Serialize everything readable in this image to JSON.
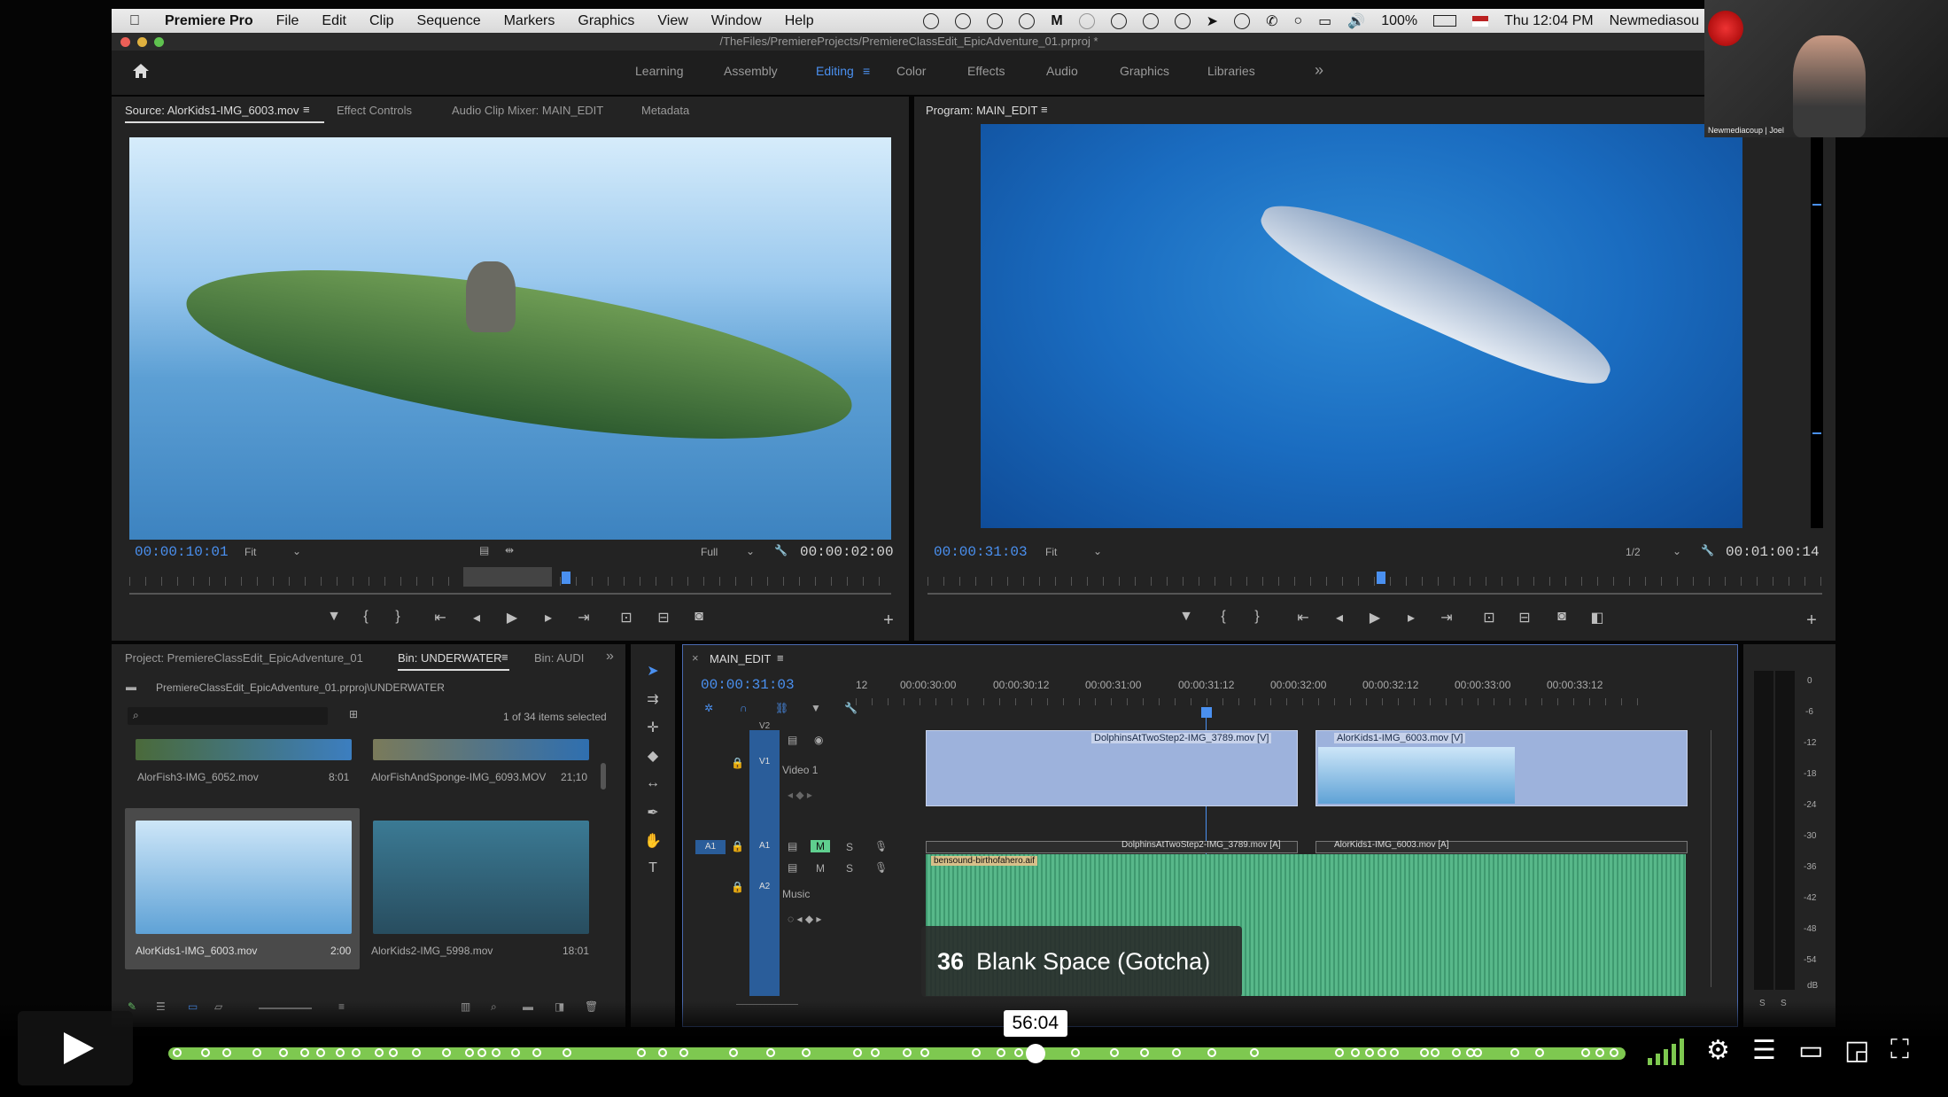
{
  "menubar": {
    "app": "Premiere Pro",
    "items": [
      "File",
      "Edit",
      "Clip",
      "Sequence",
      "Markers",
      "Graphics",
      "View",
      "Window",
      "Help"
    ],
    "battery": "100%",
    "clock": "Thu 12:04 PM",
    "user": "Newmediasou"
  },
  "titlebar": {
    "path": "/TheFiles/PremiereProjects/PremiereClassEdit_EpicAdventure_01.prproj *"
  },
  "workspaces": {
    "items": [
      {
        "label": "Learning"
      },
      {
        "label": "Assembly"
      },
      {
        "label": "Editing"
      },
      {
        "label": "Color"
      },
      {
        "label": "Effects"
      },
      {
        "label": "Audio"
      },
      {
        "label": "Graphics"
      },
      {
        "label": "Libraries"
      }
    ],
    "active": "Editing",
    "more": "»"
  },
  "source": {
    "tabs": [
      "Source: AlorKids1-IMG_6003.mov",
      "Effect Controls",
      "Audio Clip Mixer: MAIN_EDIT",
      "Metadata"
    ],
    "menu": "≡",
    "timecode": "00:00:10:01",
    "fit": "Fit",
    "resolution": "Full",
    "duration": "00:00:02:00"
  },
  "program": {
    "title": "Program: MAIN_EDIT",
    "menu": "≡",
    "timecode": "00:00:31:03",
    "fit": "Fit",
    "resolution": "1/2",
    "duration": "00:01:00:14"
  },
  "project": {
    "tabs": [
      "Project: PremiereClassEdit_EpicAdventure_01",
      "Bin: UNDERWATER",
      "Bin: AUDI"
    ],
    "menu": "≡",
    "path": "PremiereClassEdit_EpicAdventure_01.prproj\\UNDERWATER",
    "selection": "1 of 34 items selected",
    "items": [
      {
        "name": "AlorFish3-IMG_6052.mov",
        "duration": "8:01"
      },
      {
        "name": "AlorFishAndSponge-IMG_6093.MOV",
        "duration": "21;10"
      },
      {
        "name": "AlorKids1-IMG_6003.mov",
        "duration": "2:00"
      },
      {
        "name": "AlorKids2-IMG_5998.mov",
        "duration": "18:01"
      }
    ]
  },
  "timeline": {
    "name": "MAIN_EDIT",
    "menu": "≡",
    "close": "×",
    "timecode": "00:00:31:03",
    "ruler": [
      "12",
      "00:00:30:00",
      "00:00:30:12",
      "00:00:31:00",
      "00:00:31:12",
      "00:00:32:00",
      "00:00:32:12",
      "00:00:33:00",
      "00:00:33:12"
    ],
    "tracks": {
      "v2": "V2",
      "v1": "V1",
      "v1_name": "Video 1",
      "a1": "A1",
      "a2": "A2",
      "a2_name": "Music",
      "m": "M",
      "s": "S"
    },
    "clips": {
      "v1_a": "DolphinsAtTwoStep2-IMG_3789.mov [V]",
      "v1_b": "AlorKids1-IMG_6003.mov [V]",
      "a1_a": "DolphinsAtTwoStep2-IMG_3789.mov [A]",
      "a1_b": "AlorKids1-IMG_6003.mov [A]",
      "a2": "bensound-birthofahero.aif"
    }
  },
  "meters": [
    "0",
    "-6",
    "-12",
    "-18",
    "-24",
    "-30",
    "-36",
    "-42",
    "-48",
    "-54",
    "dB"
  ],
  "overlay": {
    "number": "36",
    "title": "Blank Space (Gotcha)"
  },
  "player": {
    "time": "56:04",
    "progress": 0.595
  },
  "webcam": {
    "label": "Newmediacoup | Joel"
  },
  "colors": {
    "accent": "#4a90f0",
    "progress": "#7ec850",
    "audio": "#58b88a",
    "video_clip": "#9db2dc"
  }
}
